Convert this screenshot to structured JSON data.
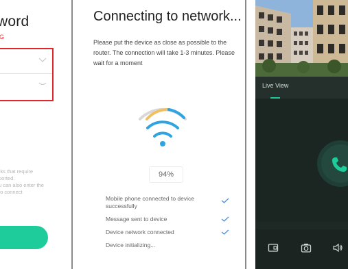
{
  "left_panel": {
    "title": "word",
    "subtitle": "G",
    "note_lines": [
      "rks that require",
      "ported.",
      "u can also enter the",
      "to connect"
    ]
  },
  "middle_panel": {
    "title": "Connecting to network...",
    "description": "Please put the device as close as possible to the router. The connection will take 1-3 minutes. Please wait for a moment",
    "progress": "94%",
    "steps": [
      {
        "label": "Mobile phone connected to device successfully",
        "done": true
      },
      {
        "label": "Message sent to device",
        "done": true
      },
      {
        "label": "Device network connected",
        "done": true
      },
      {
        "label": "Device initializing...",
        "done": false
      }
    ]
  },
  "right_panel": {
    "tab_label": "Live View",
    "toolbar": [
      "record-icon",
      "camera-icon",
      "speaker-icon"
    ]
  },
  "colors": {
    "accent": "#1ecb9a",
    "error": "#e0262b",
    "live_bg": "#1e2824"
  }
}
